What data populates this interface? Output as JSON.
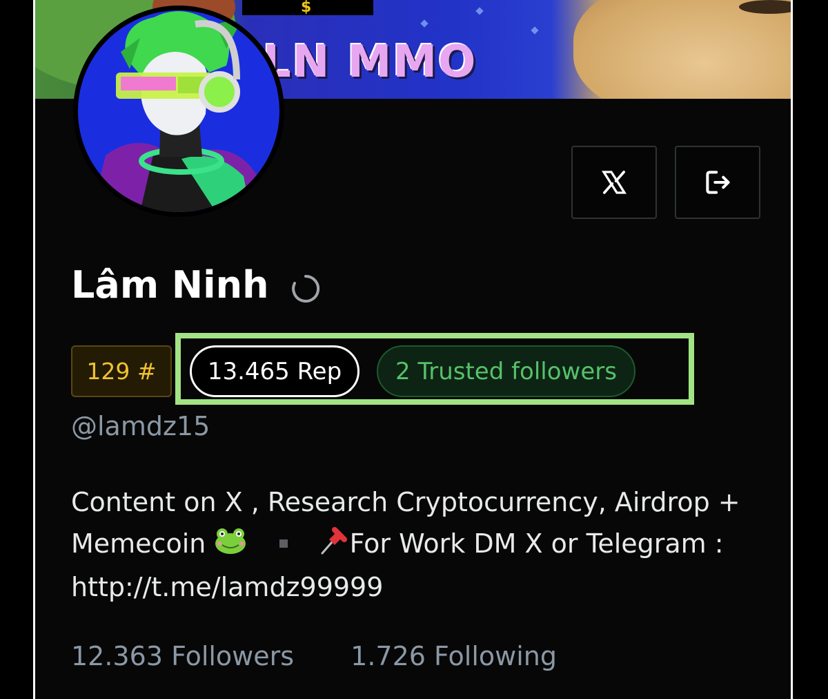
{
  "banner": {
    "title": "LN MMO",
    "currency_symbol": "$"
  },
  "profile": {
    "name": "Lâm Ninh",
    "handle": "@lamdz15",
    "rank": "129 #",
    "reputation": "13.465 Rep",
    "trusted_followers": "2 Trusted followers",
    "bio_line_1": "Content on X , Research Cryptocurrency, Airdrop +",
    "bio_line_2_a": "Memecoin",
    "bio_line_2_b": "For Work DM X or Telegram :",
    "bio_line_3": "http://t.me/lamdz99999",
    "followers_count": "12.363",
    "followers_label": "Followers",
    "following_count": "1.726",
    "following_label": "Following"
  },
  "icons": {
    "x_button": "x-logo-icon",
    "logout_button": "logout-icon",
    "verification": "loading-spinner-icon",
    "bio_frog": "frog-emoji-icon",
    "bio_pin": "pushpin-emoji-icon"
  },
  "colors": {
    "background": "#000000",
    "highlight": "#a2e485",
    "rank_gold": "#f1c232",
    "trusted_green": "#57c16a",
    "muted_text": "#8b98a5"
  }
}
